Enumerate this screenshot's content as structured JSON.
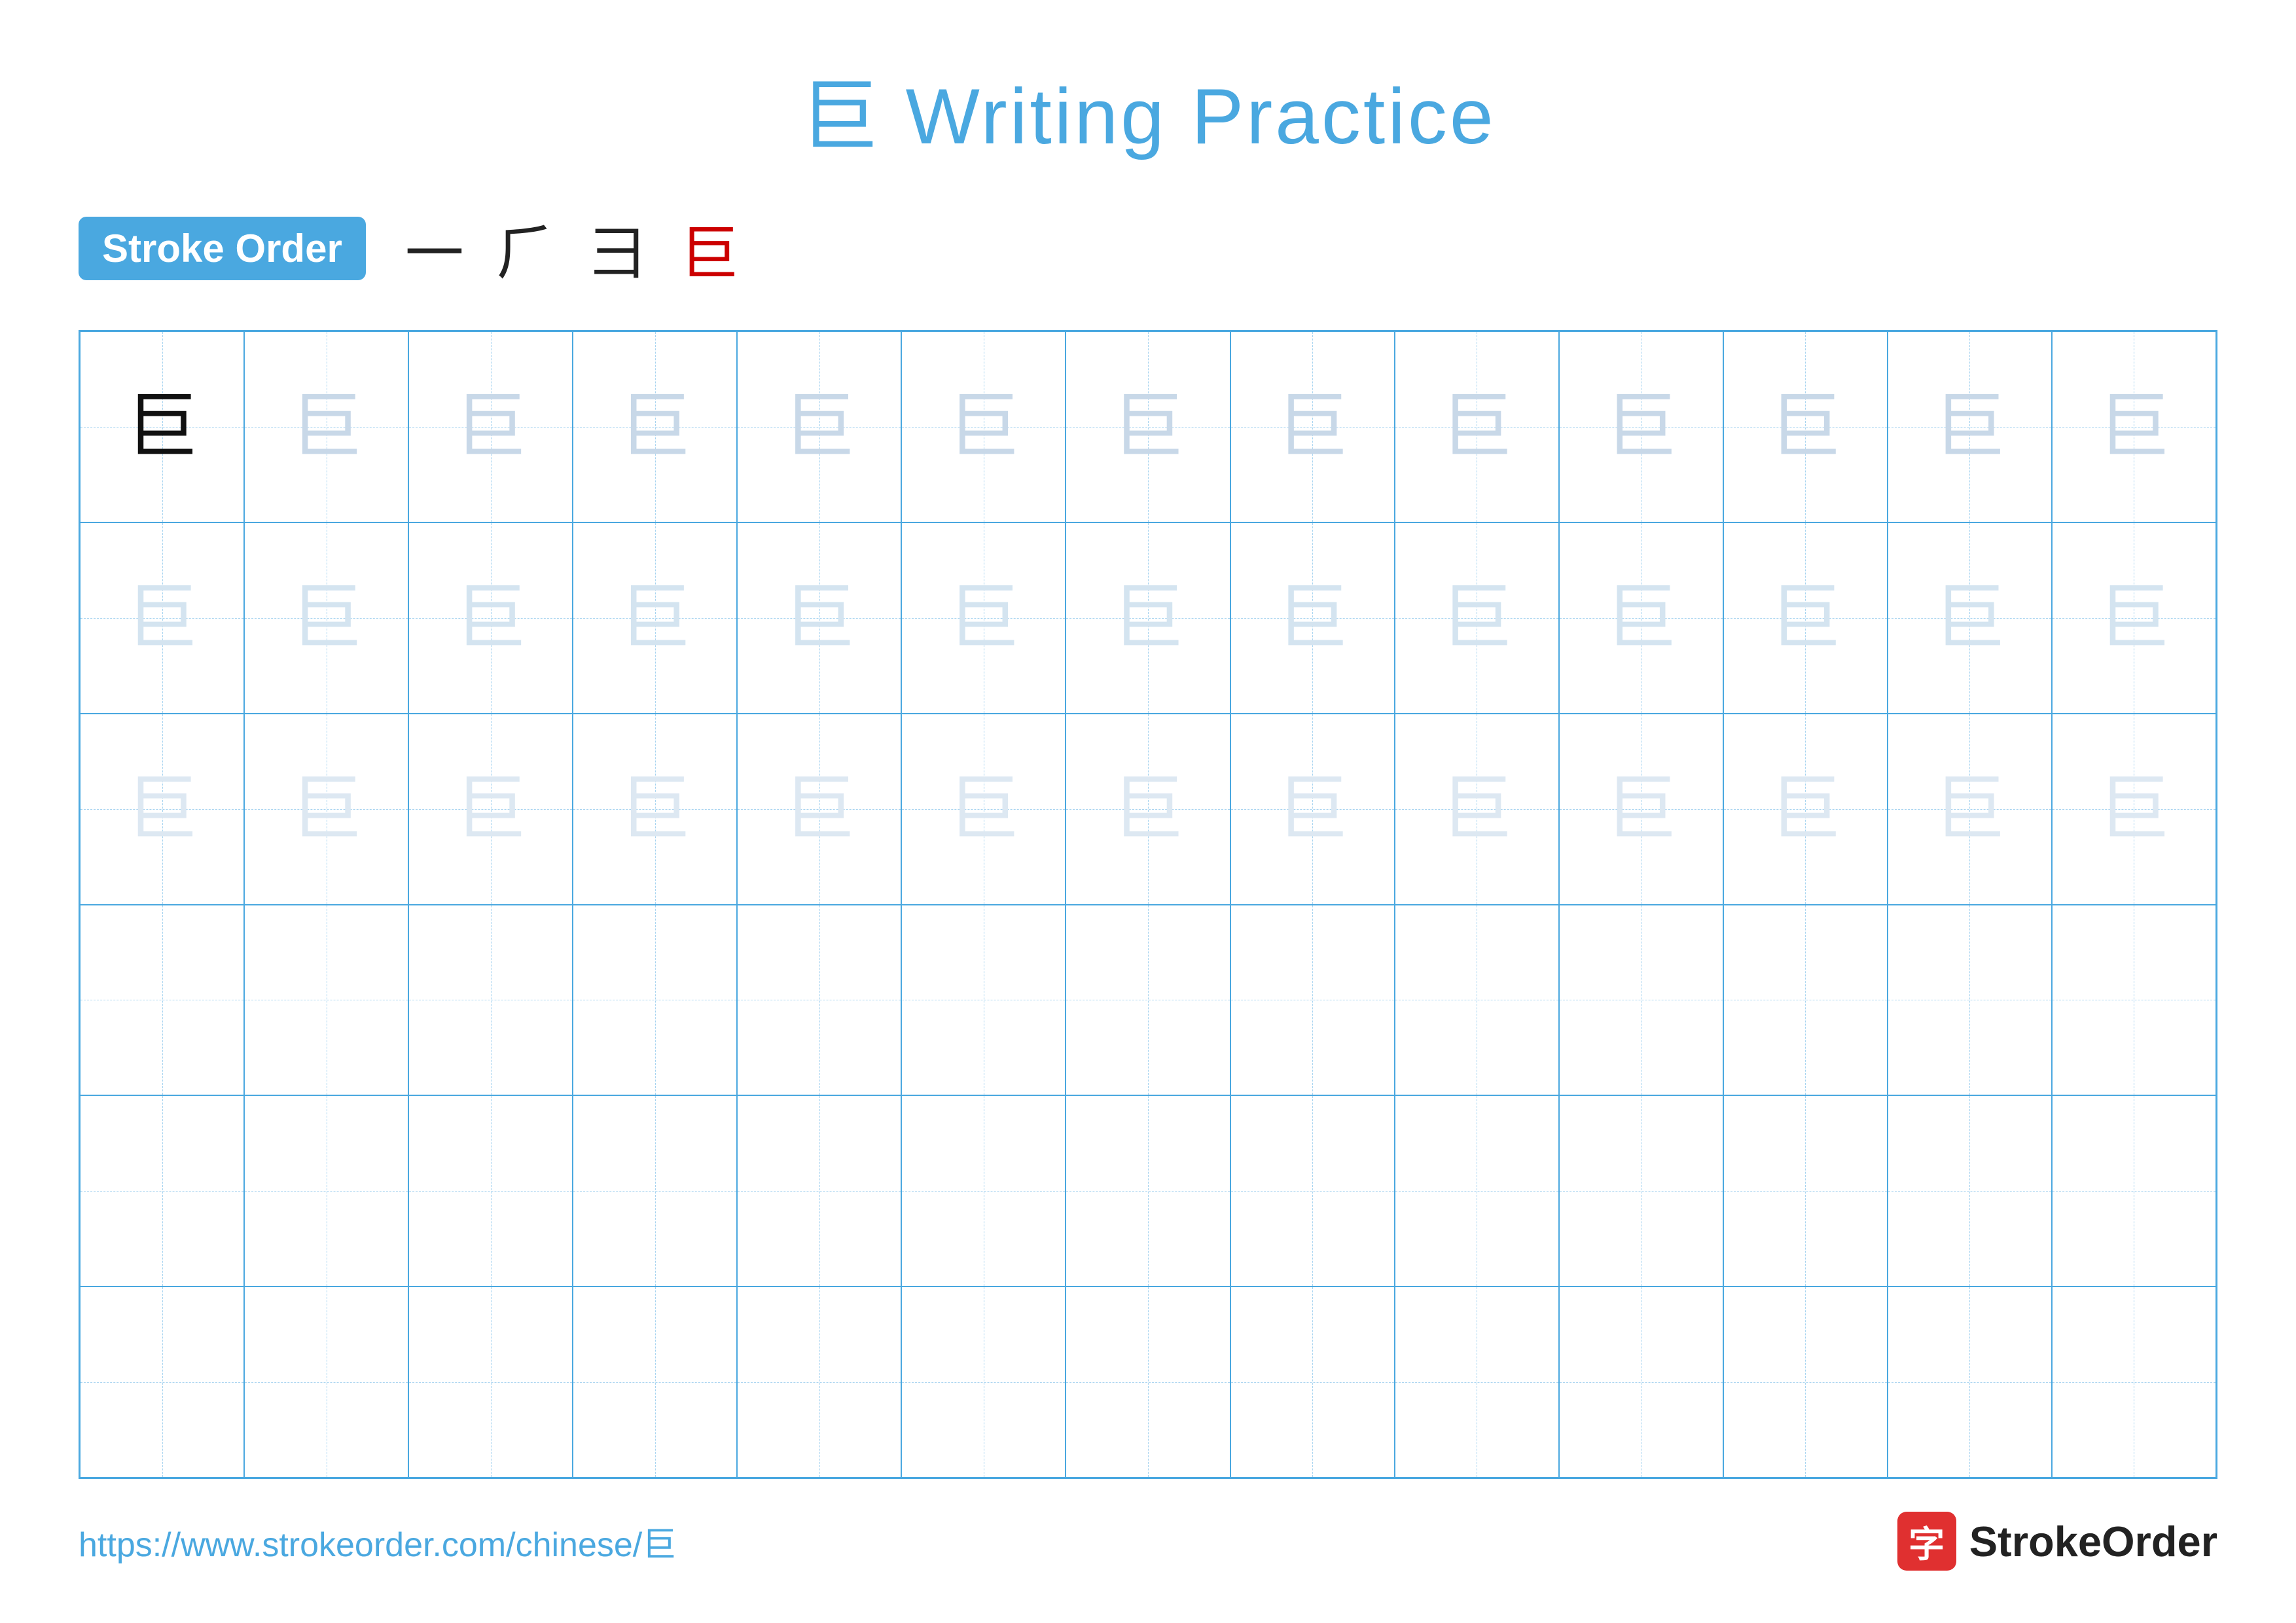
{
  "title": "巨 Writing Practice",
  "stroke_order": {
    "badge_label": "Stroke Order",
    "strokes": [
      "一",
      "⺁",
      "彐",
      "巨"
    ]
  },
  "grid": {
    "rows": 6,
    "cols": 13,
    "char": "巨",
    "row_styles": [
      "row0",
      "row1",
      "row2",
      "row3",
      "row4",
      "row5"
    ]
  },
  "footer": {
    "url": "https://www.strokeorder.com/chinese/巨",
    "logo_char": "字",
    "logo_name": "StrokeOrder"
  }
}
